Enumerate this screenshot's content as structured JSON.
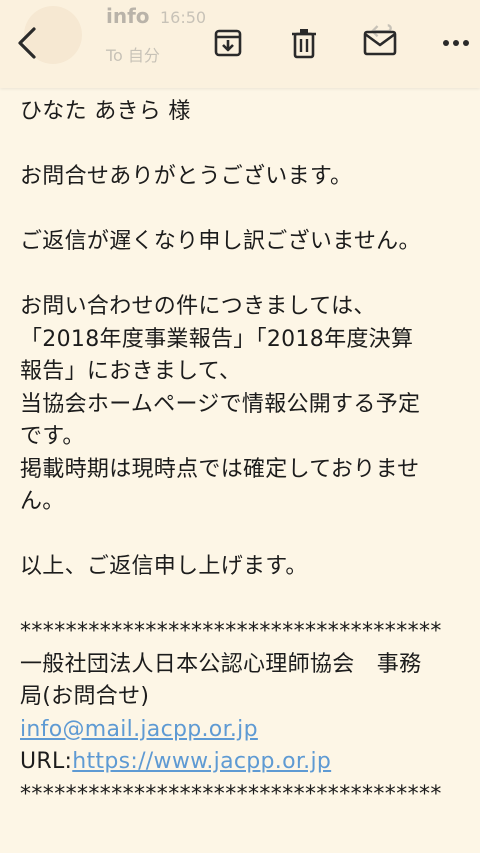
{
  "header": {
    "sender": "info",
    "time": "16:50",
    "to": "To 自分"
  },
  "toolbar": {
    "back_icon": "chevron-left-icon",
    "archive_icon": "archive-icon",
    "delete_icon": "trash-icon",
    "mark_unread_icon": "mail-icon",
    "more_icon": "more-horizontal-icon"
  },
  "message": {
    "salutation": "ひなた あきら 様",
    "thanks": "お問合せありがとうございます。",
    "apology": "ご返信が遅くなり申し訳ございません。",
    "para_lines": [
      "お問い合わせの件につきましては、",
      "「2018年度事業報告」「2018年度決算",
      "報告」におきまして、",
      "当協会ホームページで情報公開する予定",
      "です。",
      "掲載時期は現時点では確定しておりませ",
      "ん。"
    ],
    "closing": "以上、ご返信申し上げます。",
    "signature": {
      "divider_top": "*************************************",
      "org_line1": "一般社団法人日本公認心理師協会　事務",
      "org_line2": "局(お問合せ)",
      "email": "info@mail.jacpp.or.jp",
      "url_label": "URL:",
      "url": "https://www.jacpp.or.jp",
      "divider_bottom": "*************************************"
    }
  },
  "colors": {
    "background": "#fdf6e6",
    "toolbar": "#fbf1de",
    "link": "#5e9ad3"
  }
}
